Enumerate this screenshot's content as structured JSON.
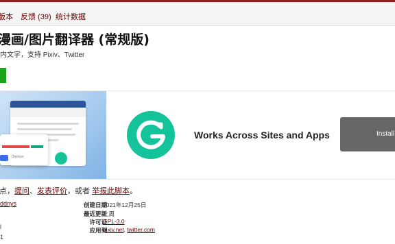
{
  "subnav": {
    "versions": "版本",
    "feedback": "反馈 (39)",
    "stats": "统计数据"
  },
  "script": {
    "title": "漫画/图片翻译器 (常规版)",
    "description": "内文字，支持 Pixiv、Twitter"
  },
  "ad": {
    "headline": "Works Across Sites and Apps",
    "button": "Install"
  },
  "feedback_line": {
    "prefix": "点，",
    "ask": "提问",
    "sep1": "、",
    "review": "发表评价",
    "mid": "，或者",
    "report": "举报此脚本",
    "suffix": "。"
  },
  "author_fragment": "ddnys",
  "meta_left_a": "l",
  "meta_left_b": "1",
  "meta": {
    "created_label": "创建日期",
    "created_value": "2021年12月25日",
    "updated_label": "最近更新",
    "updated_value": "上周",
    "license_label": "许可证",
    "license_value": "GPL-3.0",
    "applies_label": "应用到",
    "applies_1": "pixiv.net",
    "applies_sep": ", ",
    "applies_2": "twitter.com"
  },
  "colors": {
    "brand": "#670000",
    "install_green": "#1aa31a",
    "grammarly_green": "#15c39a"
  }
}
